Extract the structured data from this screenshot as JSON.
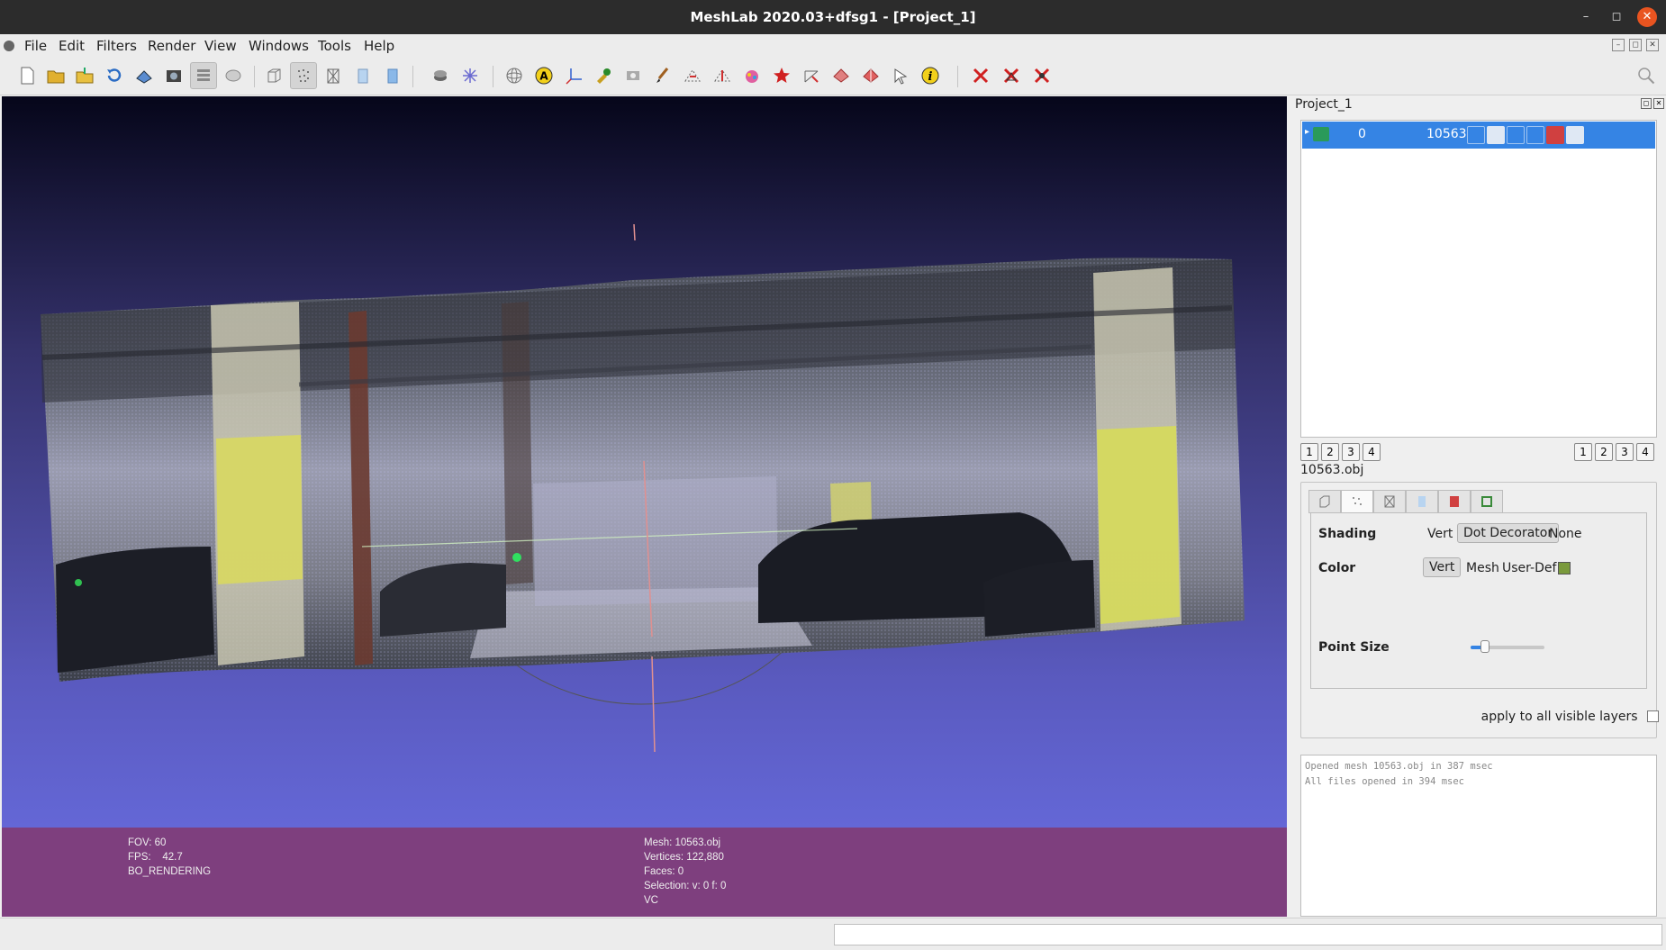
{
  "window": {
    "title": "MeshLab 2020.03+dfsg1 - [Project_1]"
  },
  "menubar": {
    "items": [
      "File",
      "Edit",
      "Filters",
      "Render",
      "View",
      "Windows",
      "Tools",
      "Help"
    ]
  },
  "toolbar": {
    "icons": [
      "new-project-icon",
      "open-project-icon",
      "import-mesh-icon",
      "reload-icon",
      "export-mesh-icon",
      "snapshot-icon",
      "layers-icon",
      "raster-icon",
      "bounding-box-icon",
      "points-render-icon",
      "wireframe-icon",
      "flat-shading-icon",
      "smooth-shading-icon",
      "lighting-icon",
      "color-mode-icon",
      "trackball-icon",
      "annotation-icon",
      "axes-icon",
      "select-vertices-icon",
      "raster-align-icon",
      "paint-icon",
      "select-faces-icon",
      "connected-select-icon",
      "z-painting-icon",
      "georef-icon",
      "measure-icon",
      "select-region-icon",
      "manipulator-icon",
      "pick-points-icon",
      "info-icon",
      "delete-vertices-icon",
      "delete-faces-icon",
      "delete-all-icon"
    ]
  },
  "viewport": {
    "info_left": [
      "FOV: 60",
      "FPS:    42.7",
      "BO_RENDERING"
    ],
    "info_right": [
      "Mesh: 10563.obj",
      "Vertices: 122,880",
      "Faces: 0",
      "Selection: v: 0 f: 0",
      "VC"
    ],
    "colors": {
      "bg_top": "#06061a",
      "bg_bottom": "#6467d6",
      "infobar": "#7e3f7e"
    }
  },
  "right_panel": {
    "project_title": "Project_1",
    "layer": {
      "id": "0",
      "name": "10563"
    },
    "left_buttons": [
      "1",
      "2",
      "3",
      "4"
    ],
    "right_buttons": [
      "1",
      "2",
      "3",
      "4"
    ],
    "file_label": "10563.obj",
    "decorator": {
      "shading_label": "Shading",
      "shading_options": [
        "Vert",
        "Dot Decorator",
        "None"
      ],
      "shading_selected": "Dot Decorator",
      "color_label": "Color",
      "color_options": [
        "Vert",
        "Mesh",
        "User-Def"
      ],
      "color_selected": "Vert",
      "user_color": "#7a9a3c",
      "point_size_label": "Point Size",
      "point_size_fraction": 0.2
    },
    "apply_label": "apply to all visible layers",
    "log": [
      "Opened mesh 10563.obj in 387 msec",
      "All files opened in 394 msec"
    ]
  }
}
